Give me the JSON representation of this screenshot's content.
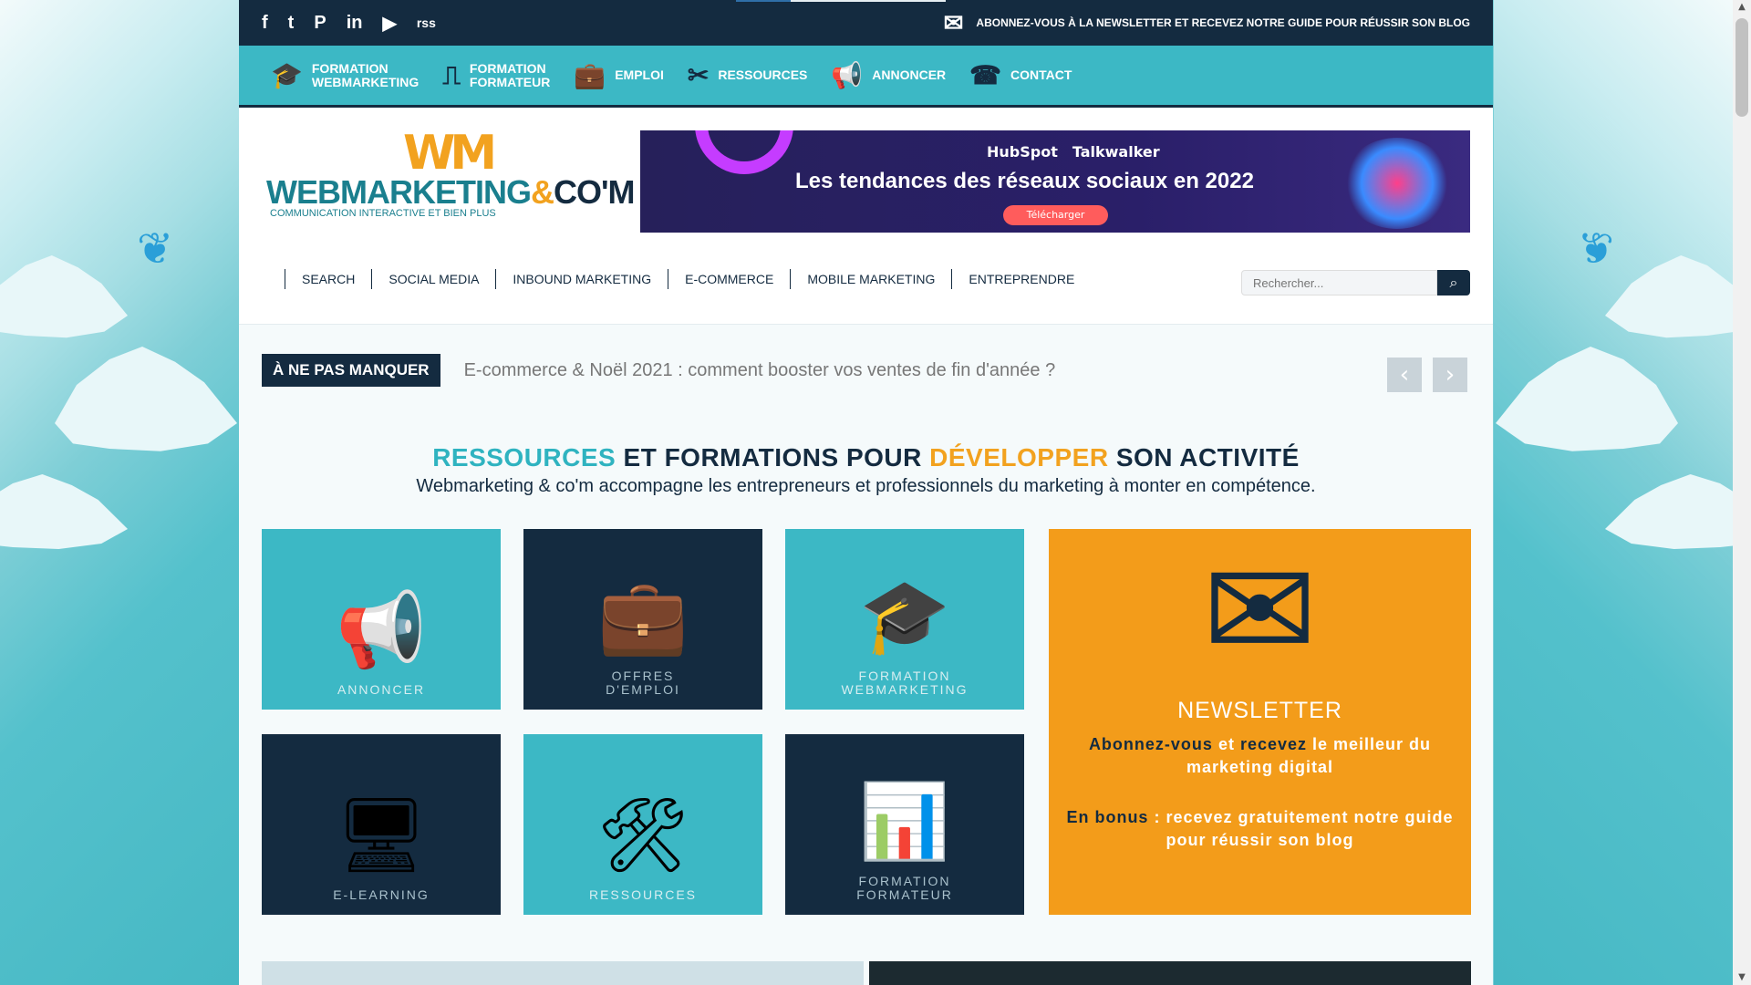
{
  "topbar": {
    "social": [
      "f",
      "t",
      "P",
      "in",
      "▶",
      "rss"
    ],
    "newsletter_text": "ABONNEZ-VOUS À LA NEWSLETTER ET RECEVEZ NOTRE GUIDE POUR RÉUSSIR SON BLOG"
  },
  "mainnav": [
    {
      "label_line1": "FORMATION",
      "label_line2": "WEBMARKETING",
      "icon": "graduation-cap-icon"
    },
    {
      "label_line1": "FORMATION",
      "label_line2": "FORMATEUR",
      "icon": "presentation-board-icon"
    },
    {
      "label_line1": "EMPLOI",
      "label_line2": "",
      "icon": "briefcase-icon"
    },
    {
      "label_line1": "RESSOURCES",
      "label_line2": "",
      "icon": "tools-icon"
    },
    {
      "label_line1": "ANNONCER",
      "label_line2": "",
      "icon": "megaphone-icon"
    },
    {
      "label_line1": "CONTACT",
      "label_line2": "",
      "icon": "phone-icon"
    }
  ],
  "header": {
    "logo_mark": "WM",
    "logo_name_1": "WEBMARKETING",
    "logo_amp": "&",
    "logo_name_2": "CO'M",
    "logo_tag": "COMMUNICATION INTERACTIVE ET BIEN PLUS",
    "banner_brand_1": "HubSpot",
    "banner_brand_2": "Talkwalker",
    "banner_headline": "Les tendances des réseaux sociaux en 2022",
    "banner_cta": "Télécharger"
  },
  "categories": [
    "SEARCH",
    "SOCIAL MEDIA",
    "INBOUND MARKETING",
    "E-COMMERCE",
    "MOBILE MARKETING",
    "ENTREPRENDRE"
  ],
  "search": {
    "placeholder": "Rechercher..."
  },
  "ticker": {
    "label": "À NE PAS MANQUER",
    "text": "E-commerce & Noël 2021 : comment booster vos ventes de fin d'année ?"
  },
  "section": {
    "h_part1": "RESSOURCES",
    "h_part2": " ET FORMATIONS POUR ",
    "h_part3": "DÉVELOPPER",
    "h_part4": " SON ACTIVITÉ",
    "subtitle": "Webmarketing & co'm accompagne les entrepreneurs et professionnels du marketing à monter en compétence."
  },
  "tiles": [
    {
      "line1": "ANNONCER",
      "line2": "",
      "glyph": "📢"
    },
    {
      "line1": "OFFRES",
      "line2": "D'EMPLOI",
      "glyph": "💼"
    },
    {
      "line1": "FORMATION",
      "line2": "WEBMARKETING",
      "glyph": "🎓"
    },
    {
      "line1": "E-LEARNING",
      "line2": "",
      "glyph": "🖥"
    },
    {
      "line1": "RESSOURCES",
      "line2": "",
      "glyph": "🛠"
    },
    {
      "line1": "FORMATION",
      "line2": "FORMATEUR",
      "glyph": "📊"
    }
  ],
  "newsletter": {
    "title": "NEWSLETTER",
    "p1_a": "Abonnez-vous",
    "p1_b": " et ",
    "p1_c": "recevez",
    "p1_d": " le meilleur du marketing digital",
    "p2_a": "En bonus",
    "p2_b": " : recevez gratuitement notre guide pour réussir son blog"
  },
  "colors": {
    "navy": "#142b40",
    "teal": "#3cb8c5",
    "orange": "#f39c1a"
  }
}
